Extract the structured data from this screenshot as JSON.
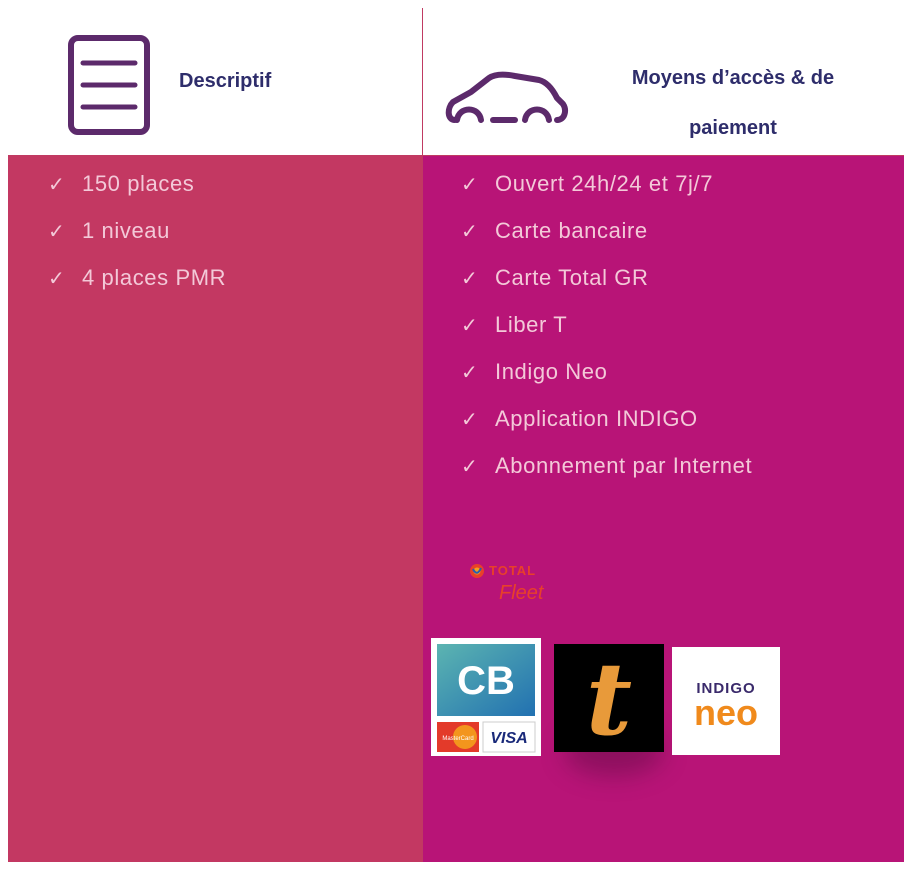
{
  "left_column": {
    "header_title": "Descriptif",
    "items": [
      "150 places",
      "1 niveau",
      "4 places PMR"
    ]
  },
  "right_column": {
    "header_title_line1": "Moyens d’accès & de",
    "header_title_line2": "paiement",
    "items": [
      "Ouvert 24h/24 et 7j/7",
      "Carte bancaire",
      "Carte Total GR",
      "Liber T",
      "Indigo Neo",
      "Application INDIGO",
      "Abonnement par Internet"
    ]
  },
  "check_glyph": "✓",
  "logos": {
    "total": {
      "line1": "TOTAL",
      "line2": "Fleet"
    },
    "cb": {
      "mark": "CB",
      "card1": "MasterCard",
      "card2": "VISA"
    },
    "libert": {
      "letter": "t"
    },
    "indigo_neo": {
      "line1": "INDIGO",
      "line2": "neo"
    }
  },
  "colors": {
    "left_bg": "#c33862",
    "right_bg": "#b81477",
    "header_text": "#2e2d6b",
    "icon_stroke": "#5c2a6b",
    "border": "#c03a62"
  }
}
